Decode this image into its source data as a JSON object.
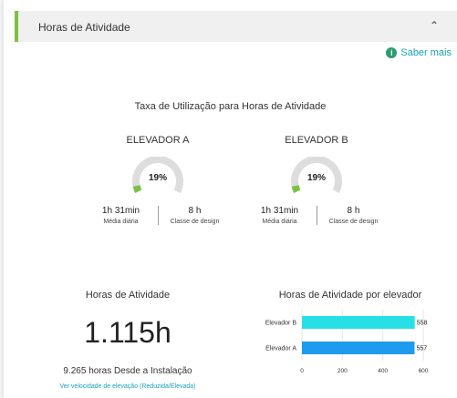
{
  "header": {
    "title": "Horas de Atividade",
    "collapse_icon": "chevron-up-icon"
  },
  "help": {
    "label": "Saber mais",
    "icon": "info-icon"
  },
  "utilization": {
    "title": "Taxa de Utilização para Horas de Atividade",
    "elevators": [
      {
        "name": "ELEVADOR A",
        "percent_label": "19%",
        "percent": 19,
        "daily_value": "1h 31min",
        "daily_label": "Média diária",
        "design_value": "8 h",
        "design_label": "Classe de design"
      },
      {
        "name": "ELEVADOR B",
        "percent_label": "19%",
        "percent": 19,
        "daily_value": "1h 31min",
        "daily_label": "Média diária",
        "design_value": "8 h",
        "design_label": "Classe de design"
      }
    ]
  },
  "hours": {
    "title": "Horas de Atividade",
    "total": "1.115h",
    "since_install": "9.265 horas Desde a Instalação",
    "link": "Ver velocidade de elevação (Reduzida/Elevada)"
  },
  "colors": {
    "accent": "#7bc143",
    "gauge_track": "#dddddd",
    "bar_b": "#27e0e6",
    "bar_a": "#1f9aef",
    "link": "#17a2b8"
  },
  "chart_data": {
    "type": "bar",
    "orientation": "horizontal",
    "title": "Horas de Atividade por elevador",
    "categories": [
      "Elevador B",
      "Elevador A"
    ],
    "values": [
      558,
      557
    ],
    "value_labels": [
      "558",
      "557"
    ],
    "colors": [
      "#27e0e6",
      "#1f9aef"
    ],
    "xlim": [
      0,
      600
    ],
    "xticks": [
      0,
      200,
      400,
      600
    ],
    "grid": true
  }
}
